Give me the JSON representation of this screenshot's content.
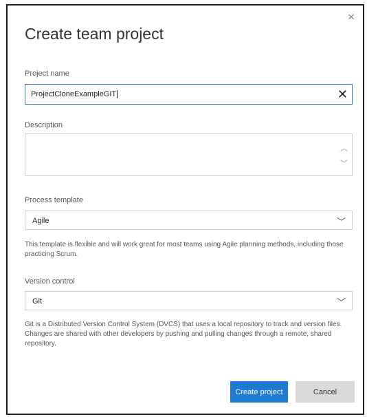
{
  "dialog": {
    "title": "Create team project",
    "close_glyph": "×"
  },
  "project_name": {
    "label": "Project name",
    "value": "ProjectCloneExampleGIT",
    "clear_glyph": "✕"
  },
  "description": {
    "label": "Description",
    "value": ""
  },
  "process_template": {
    "label": "Process template",
    "selected": "Agile",
    "help": "This template is flexible and will work great for most teams using Agile planning methods, including those practicing Scrum."
  },
  "version_control": {
    "label": "Version control",
    "selected": "Git",
    "help": "Git is a Distributed Version Control System (DVCS) that uses a local repository to track and version files. Changes are shared with other developers by pushing and pulling changes through a remote, shared repository."
  },
  "buttons": {
    "create": "Create project",
    "cancel": "Cancel"
  },
  "colors": {
    "accent": "#1e7ad3",
    "focus_border": "#2b7bd3",
    "secondary_button": "#dadada"
  },
  "icons": {
    "close": "close-icon",
    "clear": "clear-icon",
    "chevron": "chevron-down-icon",
    "scroll_up": "scroll-up-icon",
    "scroll_down": "scroll-down-icon"
  }
}
